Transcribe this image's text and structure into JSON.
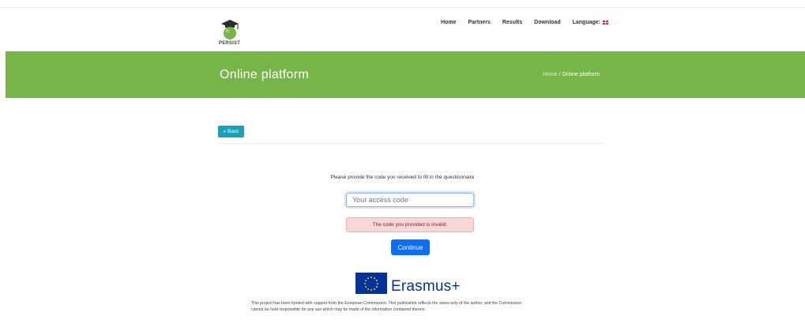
{
  "header": {
    "logo_text": "PERSIST",
    "nav": [
      {
        "label": "Home"
      },
      {
        "label": "Partners"
      },
      {
        "label": "Results"
      },
      {
        "label": "Download"
      },
      {
        "label": "Language:"
      }
    ],
    "language_flag_icon": "uk-flag-icon"
  },
  "banner": {
    "title": "Online platform",
    "breadcrumb": {
      "home": "Home",
      "separator": "/",
      "current": "Online platform"
    },
    "color": "#78b548"
  },
  "content": {
    "back_label": "« Back",
    "prompt": "Please provide the code you received to fill in the questionnaire",
    "code_input": {
      "placeholder": "Your access code",
      "value": ""
    },
    "error_message": "The code you provided is invalid.",
    "continue_label": "Continue"
  },
  "footer": {
    "program_name": "Erasmus+",
    "eu_flag_icon": "eu-flag-icon",
    "disclaimer_line1": "This project has been funded with support from the European Commission. This publication reflects the views only of the author, and the Commission",
    "disclaimer_line2": "cannot be held responsible for any use which may be made of the information contained therein."
  },
  "colors": {
    "banner": "#78b548",
    "back_button": "#17a2b8",
    "continue_button": "#0d6efd",
    "error_bg": "#f8d7da",
    "erasmus_blue": "#003399"
  }
}
